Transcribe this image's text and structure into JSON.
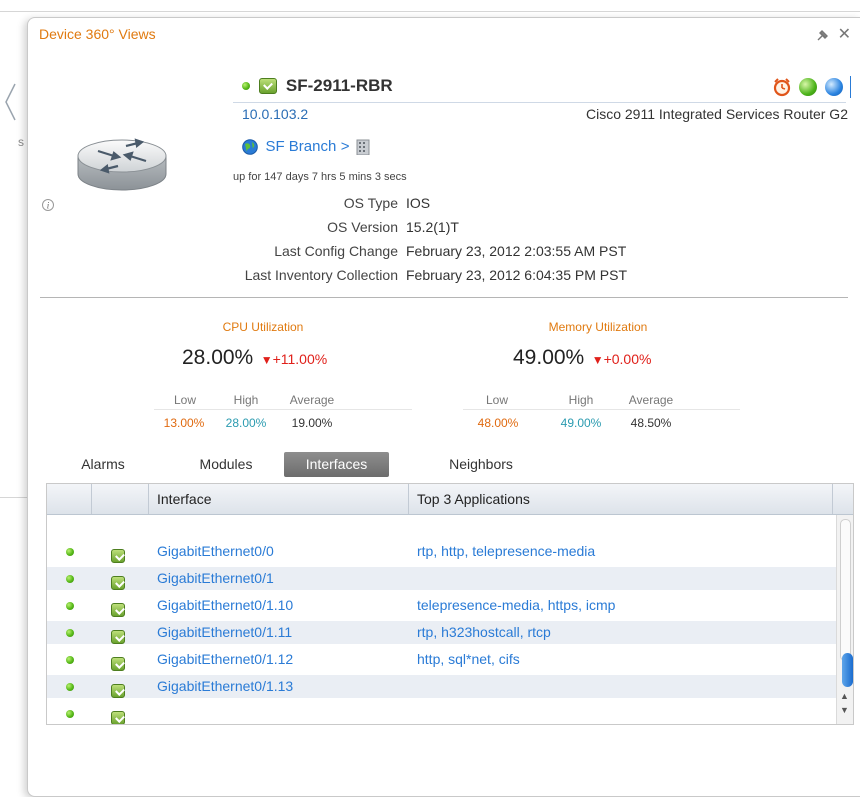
{
  "background": {
    "fragment": "s"
  },
  "panel": {
    "title": "Device 360° Views",
    "actions": {
      "pin": "✦",
      "close": "✕"
    }
  },
  "device": {
    "name": "SF-2911-RBR",
    "ip": "10.0.103.2",
    "model": "Cisco 2911 Integrated Services Router G2",
    "location": "SF Branch",
    "location_suffix": ">",
    "uptime": "up for 147 days 7 hrs 5 mins 3 secs",
    "status_color": "#56b818"
  },
  "details": [
    {
      "label": "OS Type",
      "value": "IOS"
    },
    {
      "label": "OS Version",
      "value": "15.2(1)T"
    },
    {
      "label": "Last Config Change",
      "value": "February 23, 2012 2:03:55 AM PST"
    },
    {
      "label": "Last Inventory Collection",
      "value": "February 23, 2012 6:04:35 PM PST"
    }
  ],
  "cpu": {
    "title": "CPU Utilization",
    "value": "28.00%",
    "delta": "+11.00%",
    "headers": [
      "Low",
      "High",
      "Average"
    ],
    "low": "13.00%",
    "high": "28.00%",
    "average": "19.00%"
  },
  "memory": {
    "title": "Memory Utilization",
    "value": "49.00%",
    "delta": "+0.00%",
    "headers": [
      "Low",
      "High",
      "Average"
    ],
    "low": "48.00%",
    "high": "49.00%",
    "average": "48.50%"
  },
  "tabs": [
    {
      "label": "Alarms",
      "active": false
    },
    {
      "label": "Modules",
      "active": false
    },
    {
      "label": "Interfaces",
      "active": true
    },
    {
      "label": "Neighbors",
      "active": false
    }
  ],
  "table": {
    "columns": [
      "",
      "",
      "Interface",
      "Top 3 Applications"
    ],
    "rows": [
      {
        "interface": "GigabitEthernet0/0",
        "apps": "rtp, http,  telepresence-media"
      },
      {
        "interface": "GigabitEthernet0/1",
        "apps": ""
      },
      {
        "interface": "GigabitEthernet0/1.10",
        "apps": "telepresence-media, https, icmp"
      },
      {
        "interface": "GigabitEthernet0/1.11",
        "apps": "rtp, h323hostcall, rtcp"
      },
      {
        "interface": "GigabitEthernet0/1.12",
        "apps": "http, sql*net, cifs"
      },
      {
        "interface": "GigabitEthernet0/1.13",
        "apps": ""
      }
    ]
  },
  "colors": {
    "accent": "#e07a10",
    "link": "#2a7bd6",
    "down": "#e0201a",
    "teal": "#2b9bb0"
  }
}
